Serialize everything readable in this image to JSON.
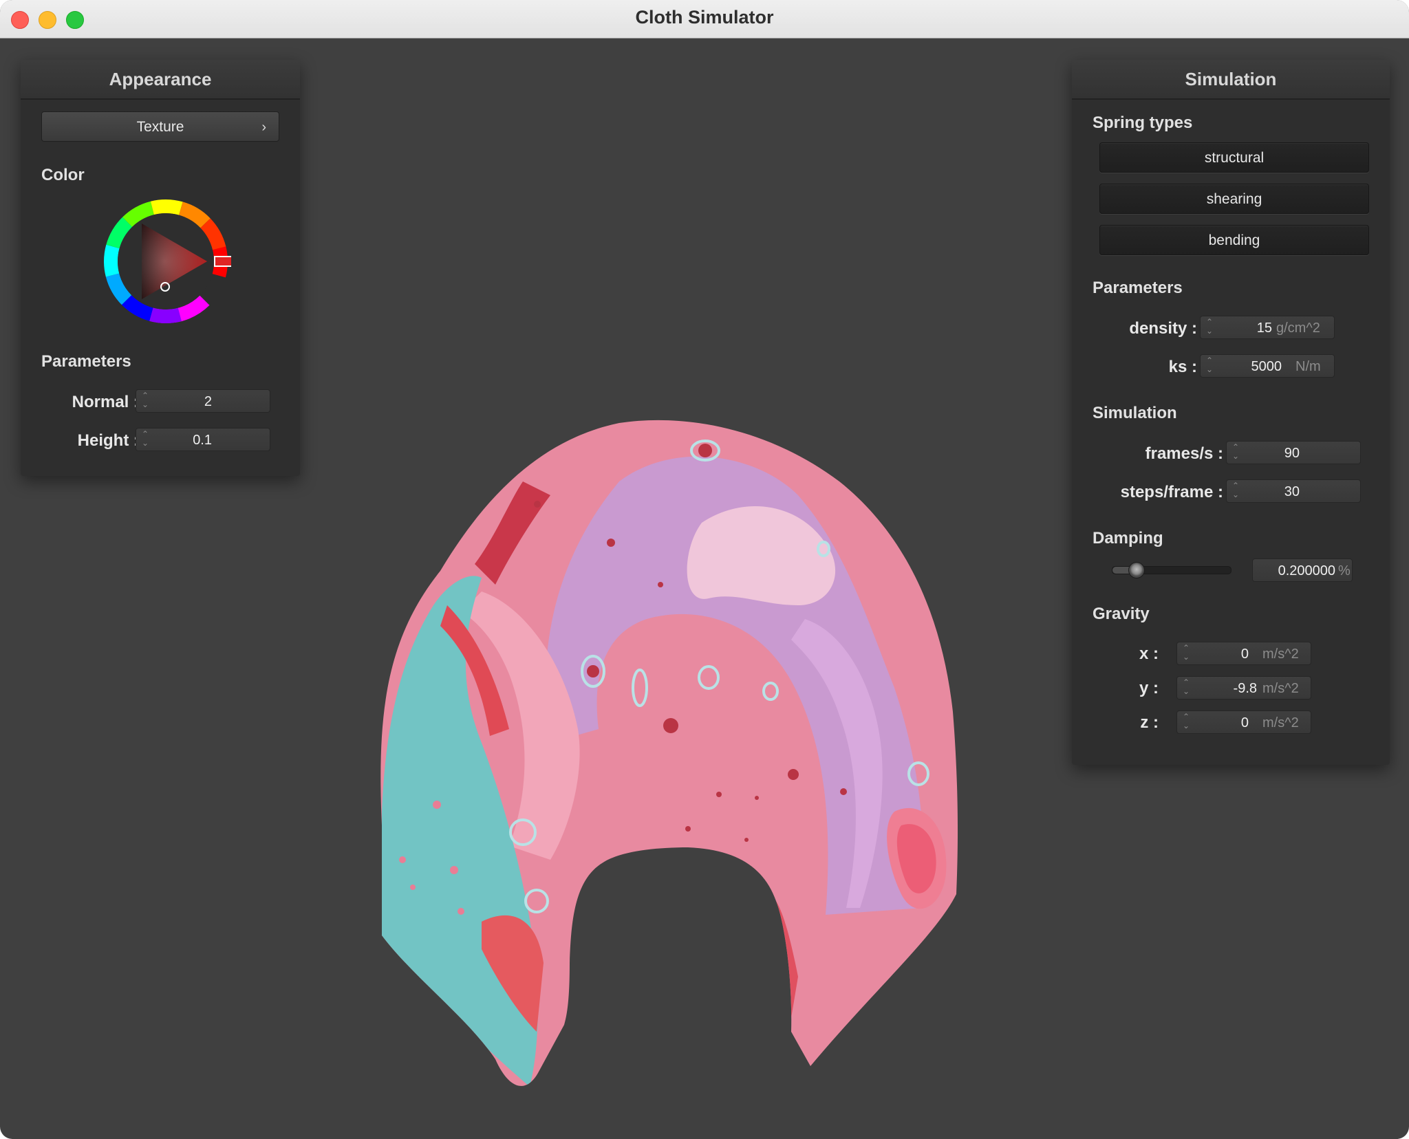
{
  "window": {
    "title": "Cloth Simulator"
  },
  "appearance": {
    "title": "Appearance",
    "texture_button": "Texture",
    "color_label": "Color",
    "selected_color": "#e02424",
    "parameters_label": "Parameters",
    "normal": {
      "label": "Normal :",
      "value": "2"
    },
    "height": {
      "label": "Height :",
      "value": "0.1"
    }
  },
  "simulation": {
    "title": "Simulation",
    "spring_types_label": "Spring types",
    "spring_buttons": [
      "structural",
      "shearing",
      "bending"
    ],
    "parameters_label": "Parameters",
    "density": {
      "label": "density :",
      "value": "15",
      "unit": "g/cm^2"
    },
    "ks": {
      "label": "ks :",
      "value": "5000",
      "unit": "N/m"
    },
    "simulation_label": "Simulation",
    "fps": {
      "label": "frames/s :",
      "value": "90"
    },
    "steps": {
      "label": "steps/frame :",
      "value": "30"
    },
    "damping_label": "Damping",
    "damping": {
      "value": "0.200000",
      "unit": "%",
      "slider_fraction": 0.2
    },
    "gravity_label": "Gravity",
    "gx": {
      "label": "x :",
      "value": "0",
      "unit": "m/s^2"
    },
    "gy": {
      "label": "y :",
      "value": "-9.8",
      "unit": "m/s^2"
    },
    "gz": {
      "label": "z :",
      "value": "0",
      "unit": "m/s^2"
    }
  },
  "colors": {
    "viewport_bg": "#404040",
    "cloth_pink": "#e88aa0",
    "cloth_lilac": "#c99ad0",
    "cloth_teal": "#72c4c4",
    "cloth_red": "#d94a55"
  }
}
